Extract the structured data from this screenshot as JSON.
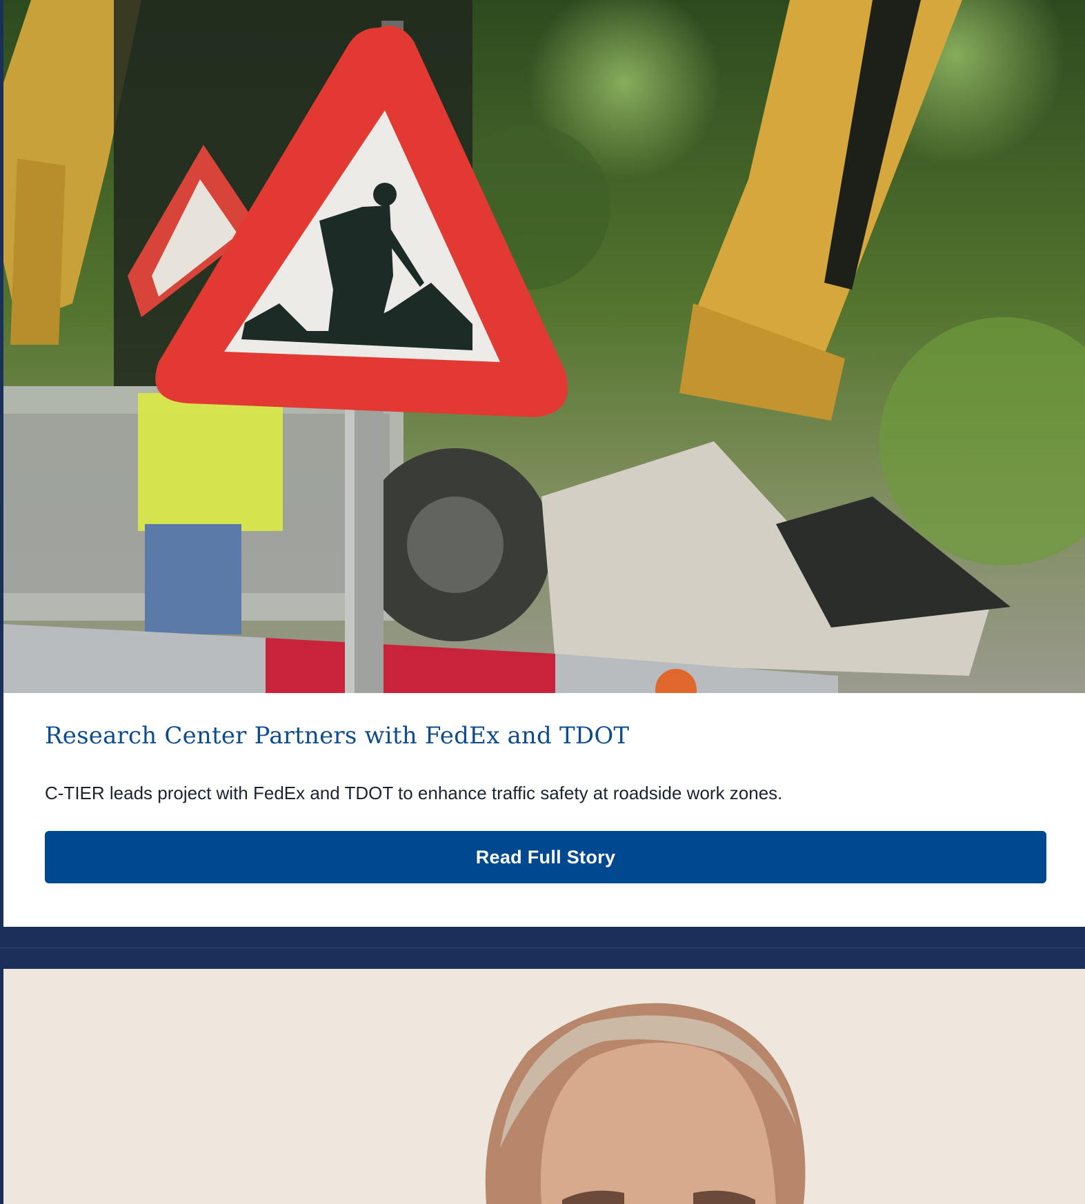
{
  "stories": [
    {
      "image_alt": "Work zone warning sign in front of an excavator",
      "title": "Research Center Partners with FedEx and TDOT",
      "summary": "C-TIER leads project with FedEx and TDOT to enhance traffic safety at roadside work zones.",
      "button_label": "Read Full Story"
    },
    {
      "image_alt": "Portrait of a man"
    }
  ],
  "colors": {
    "page_background": "#1b2f5b",
    "title": "#0d4b8f",
    "button": "#004990",
    "button_text": "#ffffff",
    "summary_text": "#1c2330"
  }
}
